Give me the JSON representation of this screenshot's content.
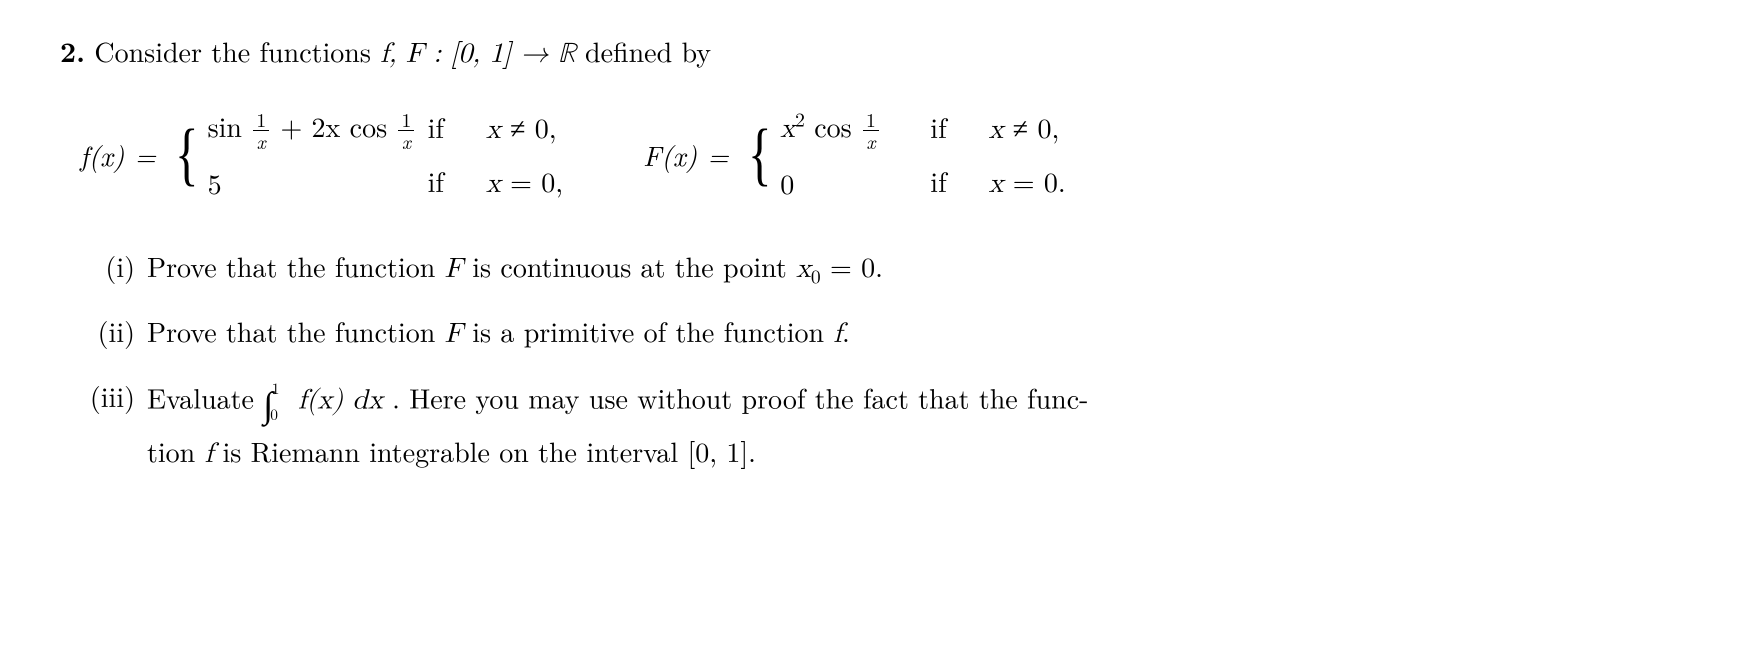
{
  "problem": {
    "number": "2.",
    "intro_pre": "Consider the functions ",
    "intro_math": "f, F : [0, 1] → ℝ",
    "intro_post": " defined by"
  },
  "eq_f": {
    "label": "f(x) = ",
    "case1_expr_pre": "sin ",
    "case1_frac1_num": "1",
    "case1_frac1_den": "x",
    "case1_expr_mid": " + 2x cos ",
    "case1_frac2_num": "1",
    "case1_frac2_den": "x",
    "case1_cond": "if   x ≠ 0,",
    "case2_expr": "5",
    "case2_cond": "if   x = 0,"
  },
  "eq_F": {
    "label": "F(x) = ",
    "case1_expr_pre": "x",
    "case1_sup": "2",
    "case1_expr_mid": " cos ",
    "case1_frac_num": "1",
    "case1_frac_den": "x",
    "case1_cond": "if   x ≠ 0,",
    "case2_expr": "0",
    "case2_cond": "if   x = 0."
  },
  "parts": {
    "i": {
      "label": "(i)",
      "pre": "Prove that the function ",
      "F": "F",
      "mid": " is continuous at the point ",
      "x0": "x",
      "x0sub": "0",
      "eq": " = 0."
    },
    "ii": {
      "label": "(ii)",
      "pre": "Prove that the function ",
      "F": "F",
      "mid": " is a primitive of the function ",
      "f": "f",
      "post": "."
    },
    "iii": {
      "label": "(iii)",
      "pre": "Evaluate ",
      "int_upper": "1",
      "int_lower": "0",
      "integrand": " f(x) dx",
      "mid": " .  Here you may use without proof the fact that the func-",
      "line2_pre": "tion ",
      "line2_f": "f",
      "line2_post": " is Riemann integrable on the interval [0, 1]."
    }
  }
}
